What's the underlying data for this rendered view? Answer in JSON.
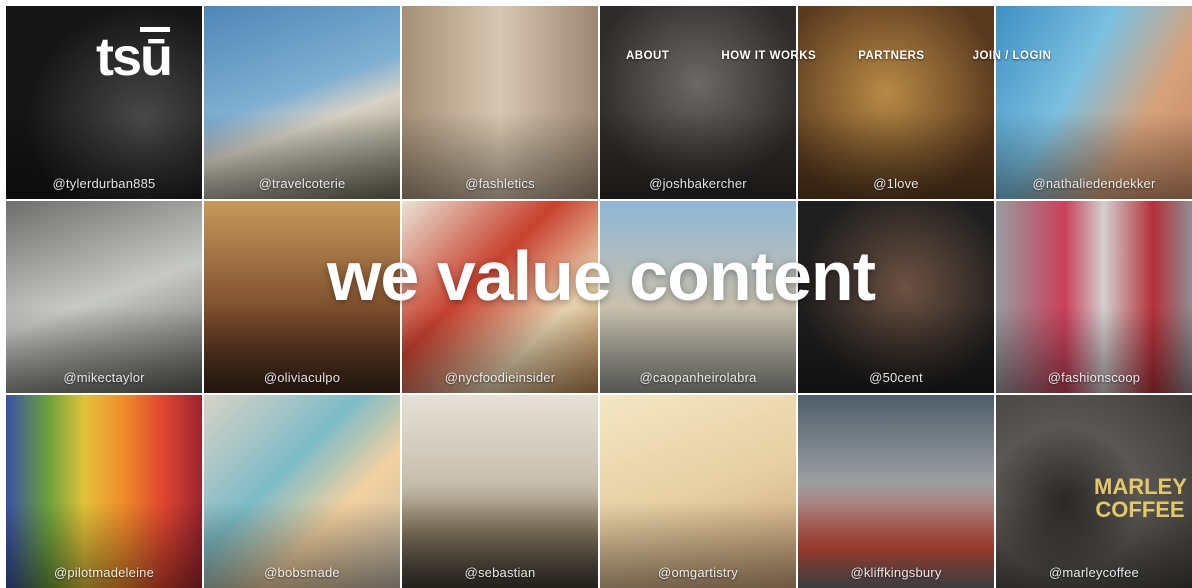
{
  "brand": {
    "logo_text": "tsū"
  },
  "nav": {
    "about": "ABOUT",
    "how_it_works": "HOW IT WORKS",
    "partners": "PARTNERS",
    "join_login": "JOIN / LOGIN"
  },
  "headline": "we value content",
  "tiles": [
    {
      "handle": "@tylerdurban885",
      "color": "#1b1b1b"
    },
    {
      "handle": "@travelcoterie",
      "color": "#5f8fb3"
    },
    {
      "handle": "@fashletics",
      "color": "#b9a48a"
    },
    {
      "handle": "@joshbakercher",
      "color": "#3a3633"
    },
    {
      "handle": "@1love",
      "color": "#6f4a2a"
    },
    {
      "handle": "@nathaliedendekker",
      "color": "#5ba7cf"
    },
    {
      "handle": "@mikectaylor",
      "color": "#8c8f8a"
    },
    {
      "handle": "@oliviaculpo",
      "color": "#a06d42"
    },
    {
      "handle": "@nycfoodieinsider",
      "color": "#c9c3b2"
    },
    {
      "handle": "@caopanheirolabra",
      "color": "#9ea7ad"
    },
    {
      "handle": "@50cent",
      "color": "#2d2d2d"
    },
    {
      "handle": "@fashionscoop",
      "color": "#8e8f95"
    },
    {
      "handle": "@pilotmadeleine",
      "color": "#3f7a33"
    },
    {
      "handle": "@bobsmade",
      "color": "#c8c1b4"
    },
    {
      "handle": "@sebastian",
      "color": "#b9b4a6"
    },
    {
      "handle": "@omgartistry",
      "color": "#d9c3a1"
    },
    {
      "handle": "@kliffkingsbury",
      "color": "#7a7c7d"
    },
    {
      "handle": "@marleycoffee",
      "color": "#4c4946"
    }
  ],
  "marley_logo": "MARLEY COFFEE"
}
